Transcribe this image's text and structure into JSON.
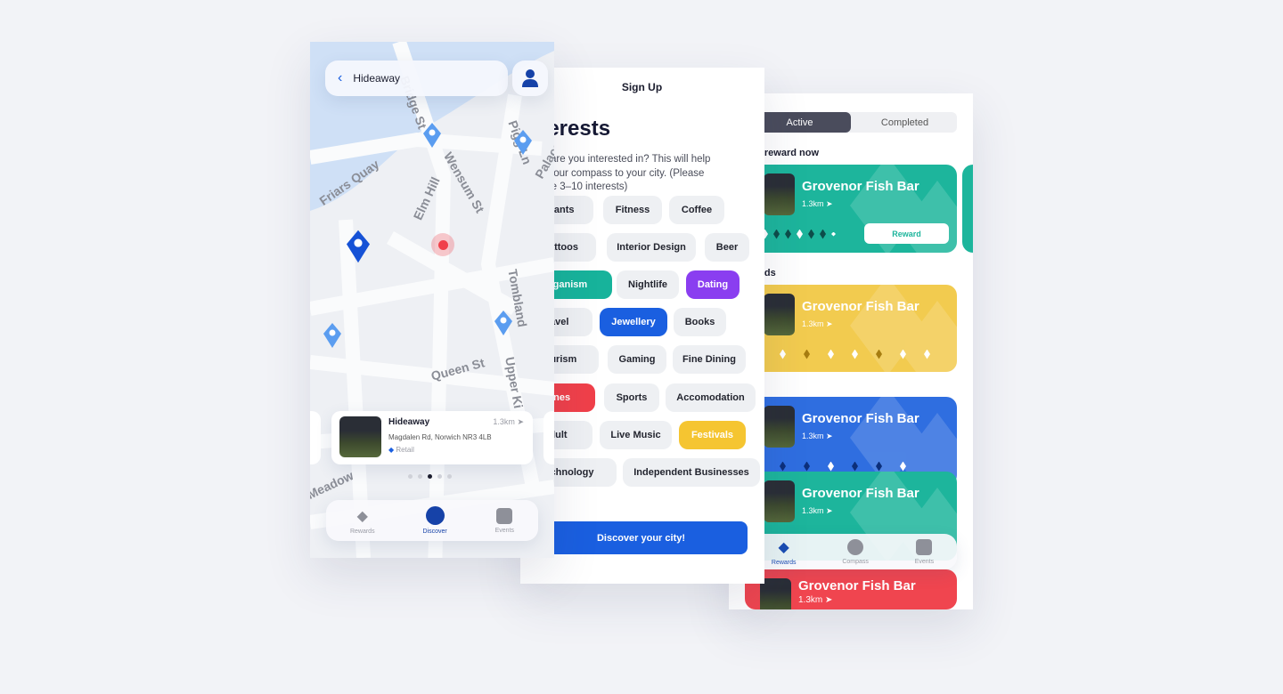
{
  "map_screen": {
    "header_title": "Hideaway",
    "street_labels": [
      "Friars Quay",
      "Elm Hill",
      "Wensum St",
      "Queen St",
      "Upper Ki",
      "Tombland",
      "Pigg Ln",
      "Palace",
      "Bridge St",
      "Meadow"
    ],
    "place_card": {
      "name": "Hideaway",
      "distance": "1.3km",
      "address": "Magdalen Rd, Norwich NR3 4LB",
      "category": "Retail"
    },
    "carousel": {
      "count": 5,
      "active_index": 2
    },
    "nav": [
      {
        "label": "Rewards",
        "icon": "rewards-icon"
      },
      {
        "label": "Discover",
        "icon": "compass-icon",
        "active": true
      },
      {
        "label": "Events",
        "icon": "calendar-icon"
      }
    ]
  },
  "signup_screen": {
    "title": "Sign Up",
    "heading": "Interests",
    "description": "What are you interested in? This will help align your compass to your city. (Please choose 3–10 interests)",
    "chips": [
      {
        "label": "Plants"
      },
      {
        "label": "Fitness"
      },
      {
        "label": "Coffee"
      },
      {
        "label": "Tattoos"
      },
      {
        "label": "Interior Design"
      },
      {
        "label": "Beer"
      },
      {
        "label": "Veganism",
        "selected": true,
        "color": "#17b39b"
      },
      {
        "label": "Nightlife"
      },
      {
        "label": "Dating",
        "selected": true,
        "color": "#8a3ef0"
      },
      {
        "label": "Travel"
      },
      {
        "label": "Jewellery",
        "selected": true,
        "color": "#1a5fe0"
      },
      {
        "label": "Books"
      },
      {
        "label": "Tourism"
      },
      {
        "label": "Gaming"
      },
      {
        "label": "Fine Dining"
      },
      {
        "label": "Wines",
        "selected": true,
        "color": "#f0404a"
      },
      {
        "label": "Sports"
      },
      {
        "label": "Accomodation"
      },
      {
        "label": "Adult"
      },
      {
        "label": "Live Music"
      },
      {
        "label": "Festivals",
        "selected": true,
        "color": "#f5c531"
      },
      {
        "label": "Technology"
      },
      {
        "label": "Independent Businesses"
      }
    ],
    "cta": "Discover your city!"
  },
  "rewards_screen": {
    "tabs": [
      {
        "label": "Active",
        "active": true
      },
      {
        "label": "Completed"
      }
    ],
    "section_claim": "Claim your reward now",
    "section_loyalty": "Loyalty Cards",
    "reward_button": "Reward",
    "cards": [
      {
        "name": "Grovenor Fish Bar",
        "distance": "1.3km",
        "color": "#1db59c"
      },
      {
        "name": "Grovenor Fish Bar",
        "distance": "1.3km",
        "color": "#f2cb4f"
      },
      {
        "name": "Grovenor Fish Bar",
        "distance": "1.3km",
        "color": "#2f6ee0"
      },
      {
        "name": "Grovenor Fish Bar",
        "distance": "1.3km",
        "color": "#1db59c"
      },
      {
        "name": "Grovenor Fish Bar",
        "distance": "1.3km",
        "color": "#f0454f"
      }
    ],
    "nav": [
      {
        "label": "Rewards",
        "icon": "rewards-icon",
        "active": true
      },
      {
        "label": "Compass",
        "icon": "compass-icon"
      },
      {
        "label": "Events",
        "icon": "calendar-icon"
      }
    ]
  }
}
